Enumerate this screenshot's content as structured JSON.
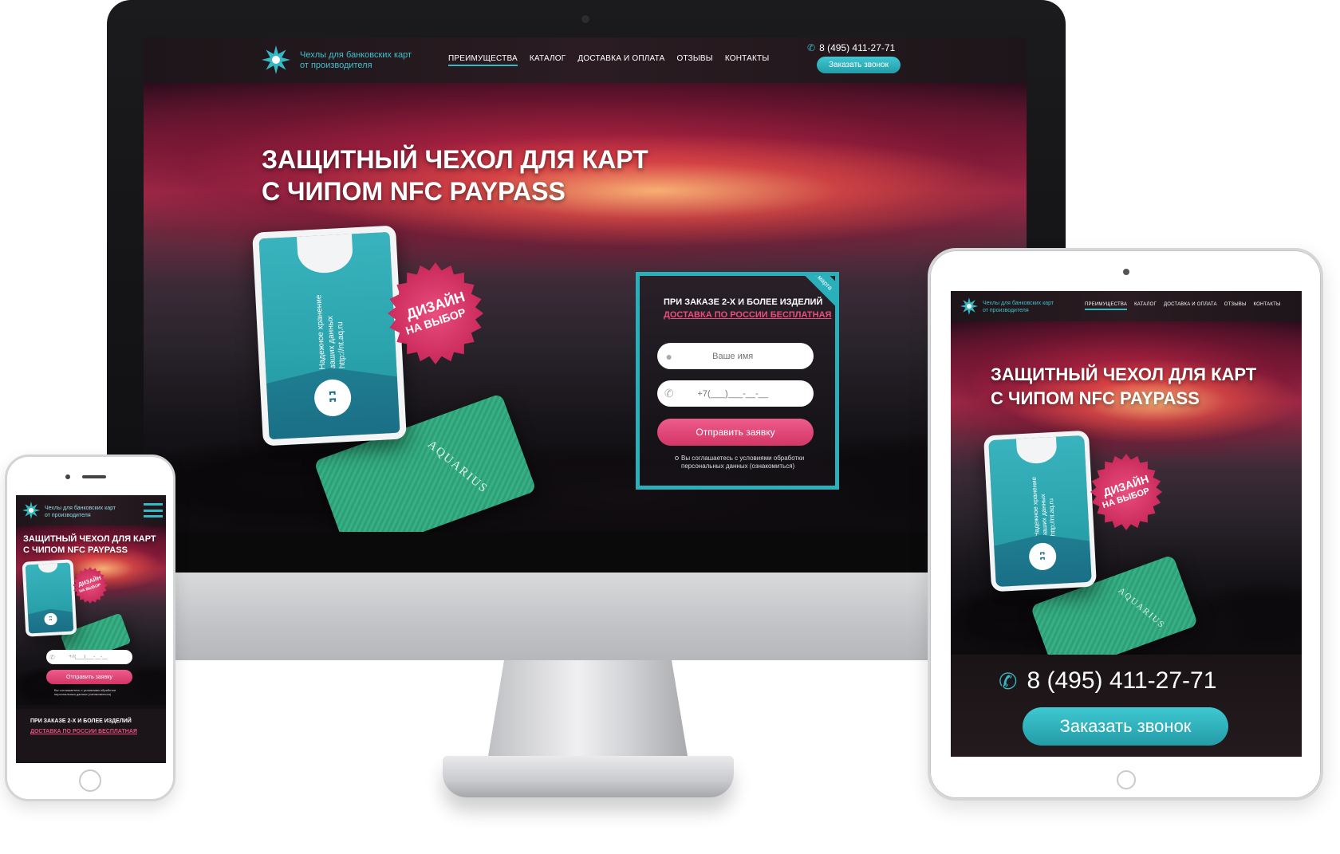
{
  "site": {
    "logo_line1": "Чехлы для банковских карт",
    "logo_line2": "от производителя",
    "nav": [
      {
        "label": "ПРЕИМУЩЕСТВА",
        "active": true
      },
      {
        "label": "КАТАЛОГ",
        "active": false
      },
      {
        "label": "ДОСТАВКА И ОПЛАТА",
        "active": false
      },
      {
        "label": "ОТЗЫВЫ",
        "active": false
      },
      {
        "label": "КОНТАКТЫ",
        "active": false
      }
    ],
    "phone": "8 (495) 411-27-71",
    "call_button": "Заказать звонок",
    "hero_title_line1": "ЗАЩИТНЫЙ ЧЕХОЛ ДЛЯ КАРТ",
    "hero_title_line2": "С ЧИПОМ NFC PAYPASS",
    "badge_line1": "ДИЗАЙН",
    "badge_line2": "НА ВЫБОР",
    "holder_print_line1": "Надежное хранение",
    "holder_print_line2": "ваших данных",
    "holder_print_line3": "http://nt.aq.ru",
    "card_brand": "AQUARIUS",
    "form": {
      "ribbon": "до 31 марта",
      "heading_line1": "ПРИ ЗАКАЗЕ 2-Х И БОЛЕЕ ИЗДЕЛИЙ",
      "heading_line2": "ДОСТАВКА ПО РОССИИ БЕСПЛАТНАЯ",
      "name_placeholder": "Ваше имя",
      "phone_placeholder": "+7(___)___-__-__",
      "submit": "Отправить заявку",
      "consent_line1": "Вы соглашаетесь с условиями обработки",
      "consent_line2": "персональных данных (ознакомиться)"
    }
  },
  "colors": {
    "accent": "#35b9c4",
    "pink": "#e94e7e",
    "header_bg": "#231a1e"
  },
  "icons": {
    "logo": "snowflake-star-icon",
    "phone": "phone-icon",
    "user": "user-icon",
    "menu": "hamburger-menu-icon"
  }
}
